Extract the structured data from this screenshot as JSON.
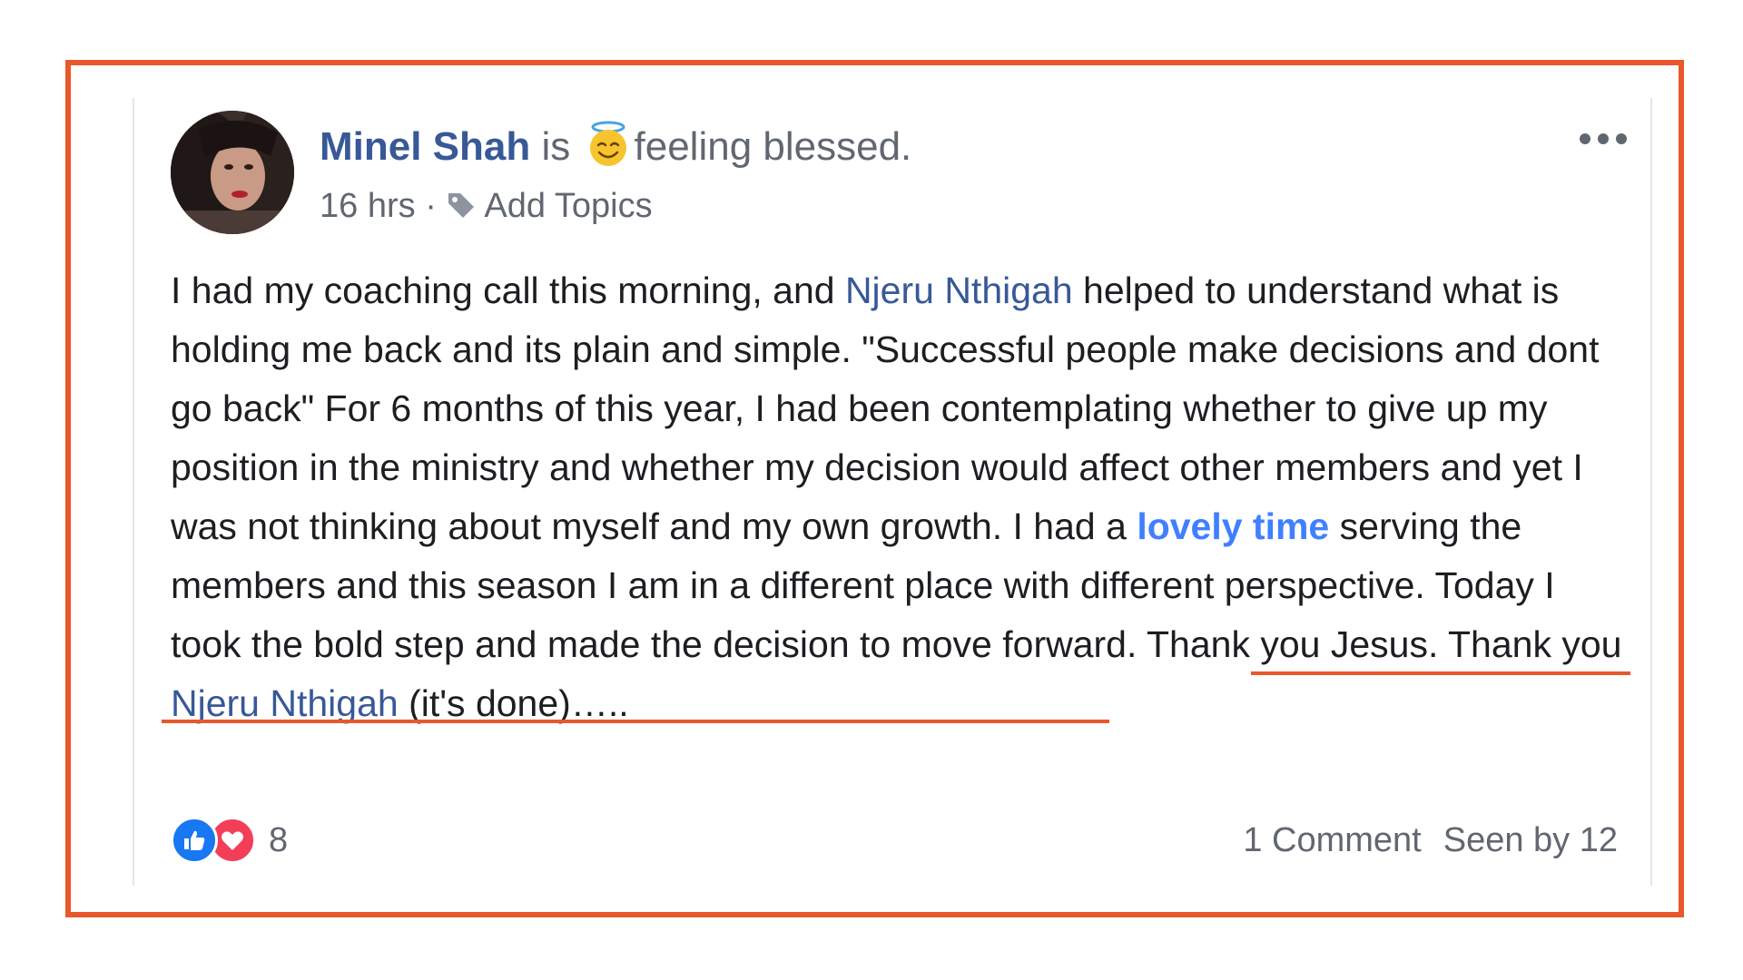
{
  "post": {
    "author": "Minel Shah",
    "verb": "is",
    "feeling_icon": "innocent-halo-emoji",
    "feeling": "feeling blessed.",
    "time": "16 hrs",
    "separator": "·",
    "tag_icon": "tag-icon",
    "add_topics": "Add Topics",
    "more_icon": "more-options-icon",
    "body": {
      "p1": "I had my coaching call this morning, and ",
      "mention1": "Njeru Nthigah",
      "p2": " helped to understand what is holding me back and its plain and simple. \"Successful people make decisions and dont go back\" For 6 months of this year, I had been contemplating whether to give up my position in the ministry and whether my decision would affect other members and yet I was not thinking about myself and my own growth. I had a ",
      "highlight": "lovely time",
      "p3": " serving the members and this season I am in a different place with different perspective. Today I took the bold step and made the decision to move forward. Thank you Jesus. Thank you ",
      "mention2": "Njeru Nthigah",
      "p4": " (it's done)….."
    },
    "reactions": {
      "icons": [
        "like-icon",
        "love-icon"
      ],
      "count": "8"
    },
    "comments": "1 Comment",
    "seen_by": "Seen by 12"
  },
  "colors": {
    "annotation_border": "#e8582a",
    "link": "#385898",
    "highlight_link": "#4080ff",
    "like": "#1877f2",
    "love": "#f33e58"
  }
}
